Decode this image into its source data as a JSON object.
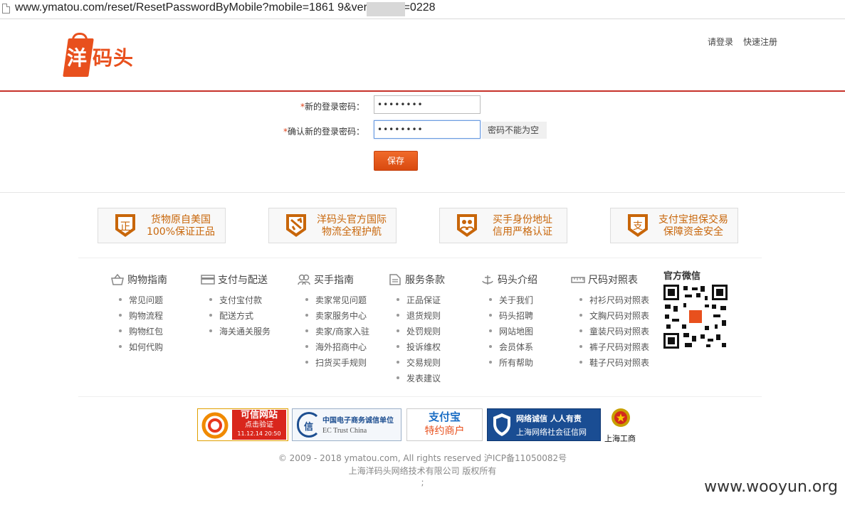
{
  "browser": {
    "url": "www.ymatou.com/reset/ResetPasswordByMobile?mobile=1861          9&verifycode=0228"
  },
  "header": {
    "logo_text": "洋码头",
    "login_link": "请登录",
    "register_link": "快速注册"
  },
  "form": {
    "required_mark": "*",
    "new_password_label": "新的登录密码：",
    "new_password_value": "••••••••",
    "confirm_password_label": "确认新的登录密码：",
    "confirm_password_value": "••••••••",
    "error_message": "密码不能为空",
    "save_label": "保存"
  },
  "features": [
    {
      "icon": "genuine-icon",
      "line1": "货物原自美国",
      "line2": "100%保证正品"
    },
    {
      "icon": "plane-icon",
      "line1": "洋码头官方国际",
      "line2": "物流全程护航"
    },
    {
      "icon": "identity-icon",
      "line1": "买手身份地址",
      "line2": "信用严格认证"
    },
    {
      "icon": "alipay-icon",
      "line1": "支付宝担保交易",
      "line2": "保障资金安全"
    }
  ],
  "footer_columns": [
    {
      "icon": "basket-icon",
      "title": "购物指南",
      "items": [
        "常见问题",
        "购物流程",
        "购物红包",
        "如何代购"
      ]
    },
    {
      "icon": "card-icon",
      "title": "支付与配送",
      "items": [
        "支付宝付款",
        "配送方式",
        "海关通关服务"
      ]
    },
    {
      "icon": "users-icon",
      "title": "买手指南",
      "items": [
        "卖家常见问题",
        "卖家服务中心",
        "卖家/商家入驻",
        "海外招商中心",
        "扫货买手规则"
      ]
    },
    {
      "icon": "document-icon",
      "title": "服务条款",
      "items": [
        "正品保证",
        "退货规则",
        "处罚规则",
        "投诉维权",
        "交易规则",
        "发表建议"
      ]
    },
    {
      "icon": "anchor-icon",
      "title": "码头介绍",
      "items": [
        "关于我们",
        "码头招聘",
        "网站地图",
        "会员体系",
        "所有帮助"
      ]
    },
    {
      "icon": "ruler-icon",
      "title": "尺码对照表",
      "items": [
        "衬衫尺码对照表",
        "文胸尺码对照表",
        "童装尺码对照表",
        "裤子尺码对照表",
        "鞋子尺码对照表"
      ]
    }
  ],
  "wechat": {
    "title": "官方微信",
    "qr_icon": "qr-code-icon"
  },
  "badges": {
    "trusted_title": "可信网站",
    "trusted_sub": "点击验证",
    "trusted_date": "11.12.14 20:50",
    "ec_title": "中国电子商务诚信单位",
    "ec_sub": "EC Trust China",
    "ec_char": "信",
    "alipay_title": "支付宝",
    "alipay_sub": "特约商户",
    "net_title": "网络诚信 人人有责",
    "net_sub": "上海网络社会征信网",
    "gongshang": "上海工商"
  },
  "copyright": {
    "line1": "© 2009 - 2018 ymatou.com, All rights reserved 沪ICP备11050082号",
    "line2": "上海洋码头网络技术有限公司 版权所有",
    "line3": ";"
  },
  "watermark": "www.wooyun.org",
  "colors": {
    "brand": "#e8501d",
    "header_line": "#c7322a",
    "feature_text": "#c8660a"
  }
}
